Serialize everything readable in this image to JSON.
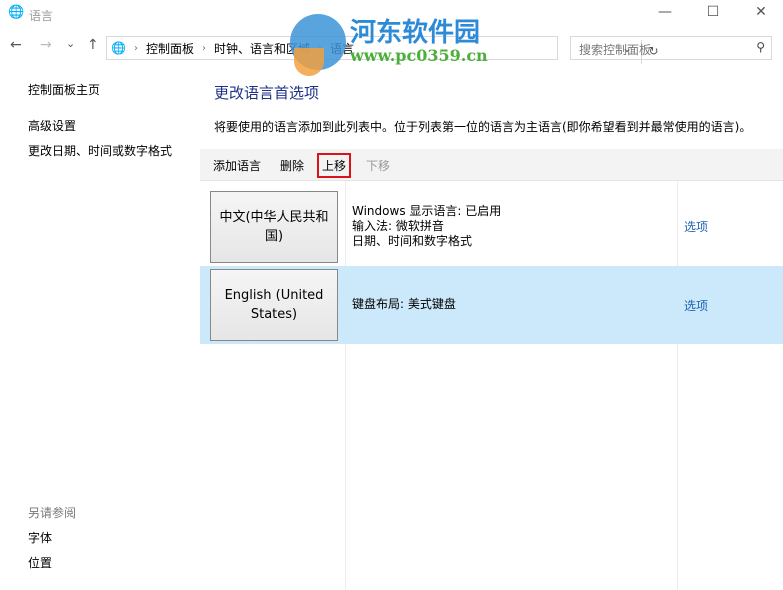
{
  "window": {
    "title": "语言",
    "minimize": "—",
    "maximize": "☐",
    "close": "✕"
  },
  "nav": {
    "back": "←",
    "forward": "→",
    "recent": "⌄",
    "up": "↑",
    "breadcrumb": [
      "控制面板",
      "时钟、语言和区域",
      "语言"
    ],
    "dropdown": "⌄",
    "refresh": "↻",
    "search_placeholder": "搜索控制面板",
    "search_icon": "⚲"
  },
  "sidebar": {
    "home": "控制面板主页",
    "links": [
      "高级设置",
      "更改日期、时间或数字格式"
    ],
    "see_also": "另请参阅",
    "see_also_links": [
      "字体",
      "位置"
    ]
  },
  "main": {
    "heading": "更改语言首选项",
    "description": "将要使用的语言添加到此列表中。位于列表第一位的语言为主语言(即你希望看到并最常使用的语言)。",
    "toolbar": {
      "add": "添加语言",
      "remove": "删除",
      "move_up": "上移",
      "move_down": "下移"
    },
    "languages": [
      {
        "name": "中文(中华人民共和国)",
        "details": [
          "Windows 显示语言: 已启用",
          "输入法: 微软拼音",
          "日期、时间和数字格式"
        ],
        "options": "选项",
        "selected": false
      },
      {
        "name": "English (United States)",
        "details": [
          "键盘布局: 美式键盘"
        ],
        "options": "选项",
        "selected": true
      }
    ]
  },
  "watermark": {
    "name": "河东软件园",
    "url": "www.pc0359.cn"
  }
}
